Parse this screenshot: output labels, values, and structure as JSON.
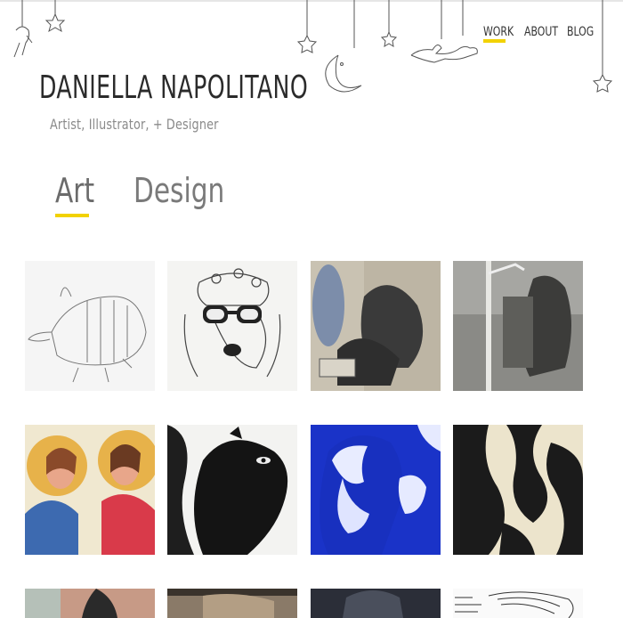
{
  "header": {
    "title": "Daniella Napolitano",
    "subtitle": "Artist, Illustrator, + Designer"
  },
  "nav": {
    "items": [
      {
        "label": "WORK",
        "active": true
      },
      {
        "label": "ABOUT",
        "active": false
      },
      {
        "label": "BLOG",
        "active": false
      }
    ]
  },
  "tabs": [
    {
      "label": "Art",
      "active": true
    },
    {
      "label": "Design",
      "active": false
    }
  ],
  "gallery": {
    "items": [
      {
        "name": "armadillo-drawing"
      },
      {
        "name": "deer-with-glasses-drawing"
      },
      {
        "name": "crows-painting"
      },
      {
        "name": "bear-streetlight-print"
      },
      {
        "name": "two-girls-painting"
      },
      {
        "name": "squirrel-drawing"
      },
      {
        "name": "blue-linocut-portrait"
      },
      {
        "name": "black-white-woodcut"
      },
      {
        "name": "partial-painting-1"
      },
      {
        "name": "partial-painting-2"
      },
      {
        "name": "partial-painting-3"
      },
      {
        "name": "partial-sketch-4"
      }
    ]
  },
  "colors": {
    "accent": "#f2d200",
    "text": "#2b2b2b",
    "muted": "#8a8a8a"
  }
}
